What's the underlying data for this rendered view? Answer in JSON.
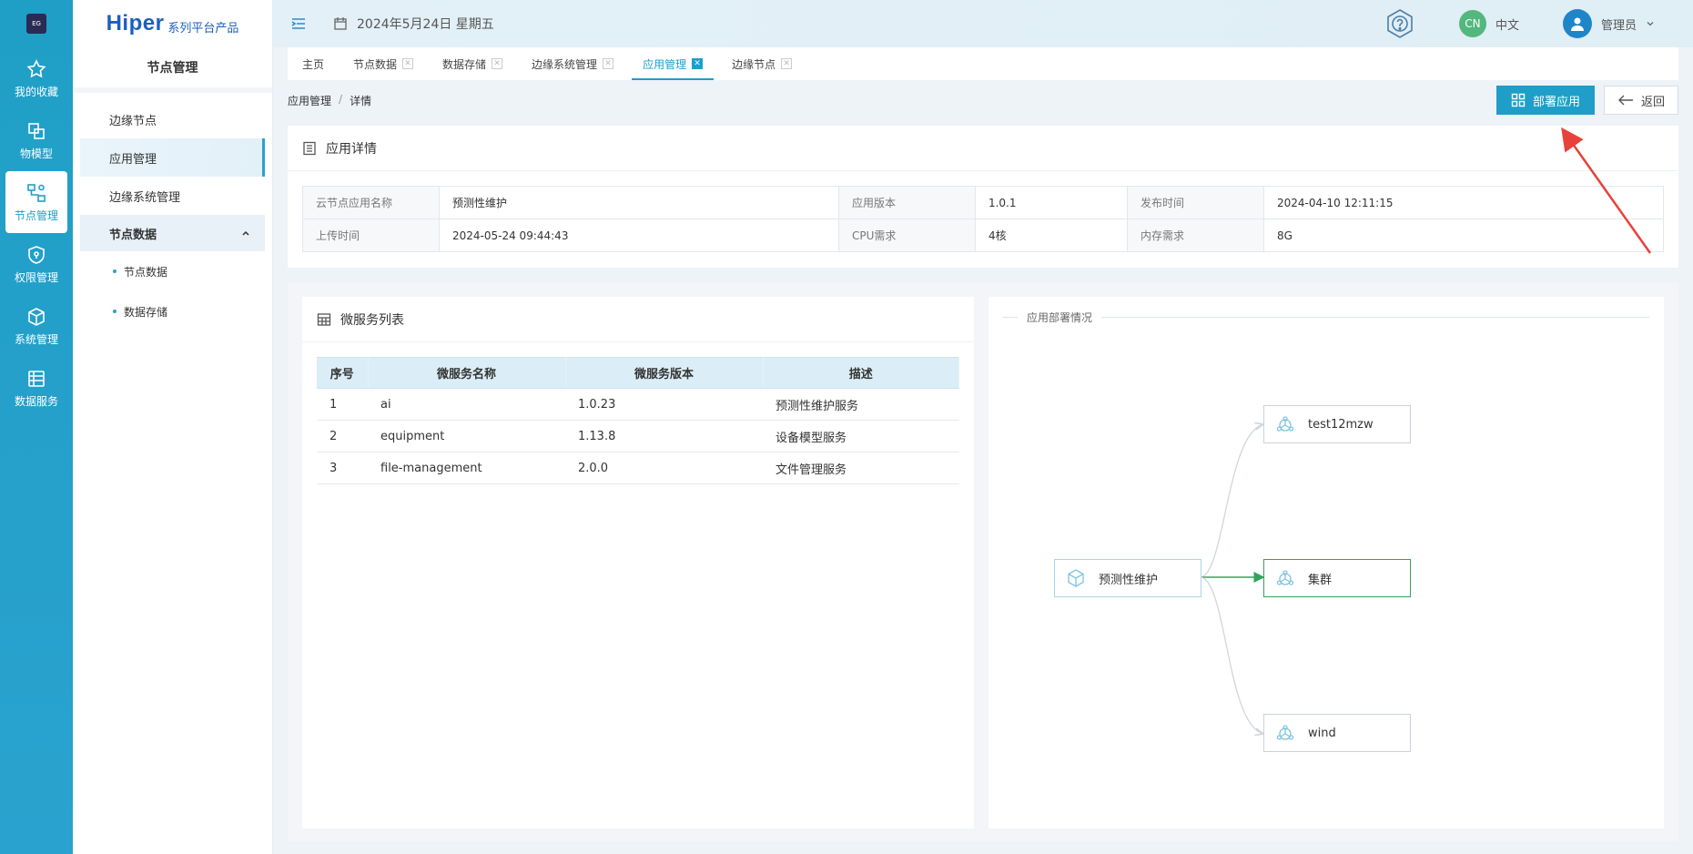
{
  "rail": {
    "logo_text": "EG",
    "items": [
      {
        "label": "我的收藏",
        "icon": "star-icon"
      },
      {
        "label": "物模型",
        "icon": "model-icon"
      },
      {
        "label": "节点管理",
        "icon": "node-manage-icon"
      },
      {
        "label": "权限管理",
        "icon": "shield-icon"
      },
      {
        "label": "系统管理",
        "icon": "cube-icon"
      },
      {
        "label": "数据服务",
        "icon": "data-service-icon"
      }
    ]
  },
  "sidebar": {
    "brand": "Hiper",
    "brand_sub": "系列平台产品",
    "title": "节点管理",
    "items": [
      "边缘节点",
      "应用管理",
      "边缘系统管理"
    ],
    "group": "节点数据",
    "sub_items": [
      "节点数据",
      "数据存储"
    ]
  },
  "header": {
    "date": "2024年5月24日 星期五",
    "lang_badge": "CN",
    "lang": "中文",
    "user": "管理员"
  },
  "tabs": [
    "主页",
    "节点数据",
    "数据存储",
    "边缘系统管理",
    "应用管理",
    "边缘节点"
  ],
  "breadcrumb": {
    "parent": "应用管理",
    "sep": "/",
    "current": "详情"
  },
  "actions": {
    "deploy": "部署应用",
    "back": "返回"
  },
  "detail": {
    "title": "应用详情",
    "rows": [
      [
        {
          "k": "云节点应用名称",
          "v": "预测性维护"
        },
        {
          "k": "应用版本",
          "v": "1.0.1"
        },
        {
          "k": "发布时间",
          "v": "2024-04-10 12:11:15"
        }
      ],
      [
        {
          "k": "上传时间",
          "v": "2024-05-24 09:44:43"
        },
        {
          "k": "CPU需求",
          "v": "4核"
        },
        {
          "k": "内存需求",
          "v": "8G"
        }
      ]
    ]
  },
  "microservices": {
    "title": "微服务列表",
    "columns": [
      "序号",
      "微服务名称",
      "微服务版本",
      "描述"
    ],
    "rows": [
      [
        "1",
        "ai",
        "1.0.23",
        "预测性维护服务"
      ],
      [
        "2",
        "equipment",
        "1.13.8",
        "设备模型服务"
      ],
      [
        "3",
        "file-management",
        "2.0.0",
        "文件管理服务"
      ]
    ]
  },
  "deploy": {
    "title": "应用部署情况",
    "source": "预测性维护",
    "targets": [
      "test12mzw",
      "集群",
      "wind"
    ],
    "colors": {
      "active_edge": "#36a15c",
      "edge": "#cfd6dc"
    }
  },
  "colors": {
    "primary": "#1e9ec8",
    "annotation_arrow": "#e8413b"
  }
}
